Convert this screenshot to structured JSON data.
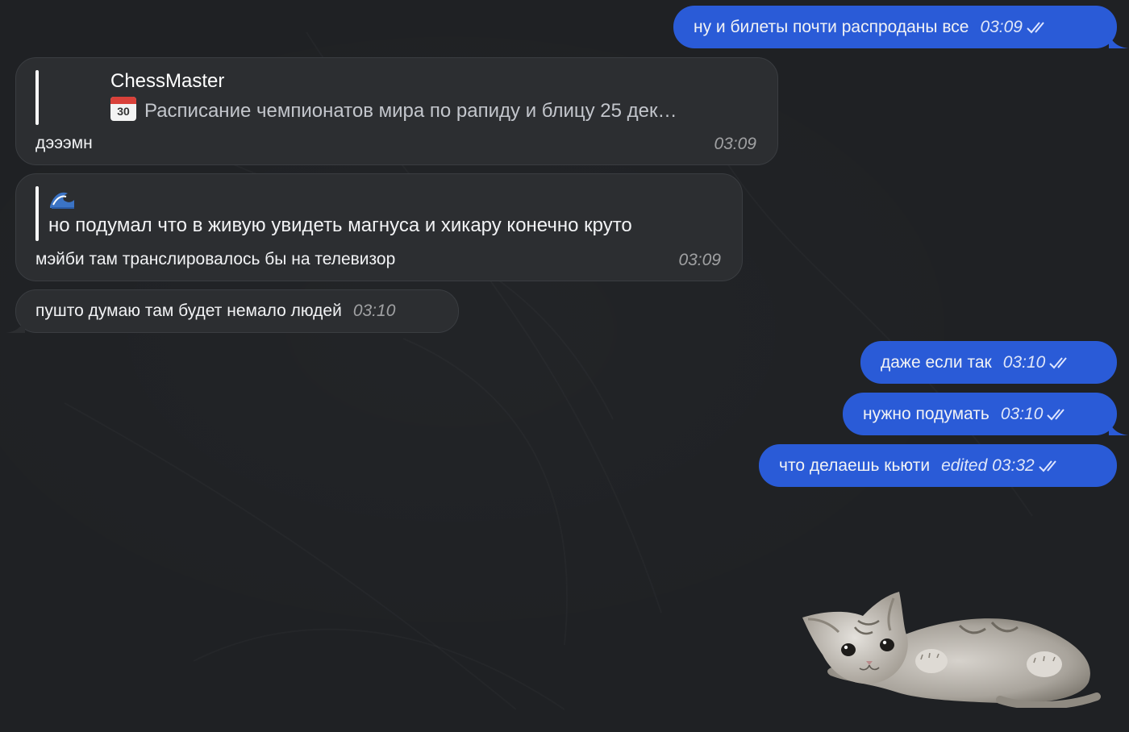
{
  "messages": {
    "out1": {
      "text": "ну и билеты почти распроданы все",
      "time": "03:09"
    },
    "in1": {
      "reply_name": "ChessMaster",
      "reply_text": "Расписание чемпионатов мира по рапиду и блицу  25 дек…",
      "reply_icon": "calendar-icon",
      "calendar_number": "30",
      "text": "дэээмн",
      "time": "03:09"
    },
    "in2": {
      "reply_icon": "wave-icon",
      "reply_text": "но подумал что в живую увидеть магнуса и хикару конечно круто",
      "text": "мэйби там транслировалось бы на телевизор",
      "time": "03:09"
    },
    "in3": {
      "text": "пушто думаю там будет немало людей",
      "time": "03:10"
    },
    "out2": {
      "text": "даже если так",
      "time": "03:10"
    },
    "out3": {
      "text": "нужно подумать",
      "time": "03:10"
    },
    "out4": {
      "text": "что делаешь кьюти",
      "time": "edited 03:32"
    }
  },
  "sticker": {
    "icon": "kitten-sticker"
  },
  "colors": {
    "background": "#1f2124",
    "outgoing_bubble": "#2a5bd7",
    "incoming_bubble": "#2c2e31"
  }
}
